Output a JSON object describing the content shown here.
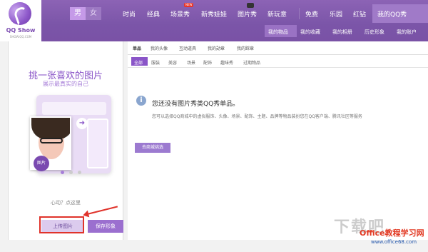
{
  "header": {
    "logo_text": "QQ Show",
    "logo_sub": "SHOW.QQ.COM",
    "gender": [
      "男",
      "女"
    ],
    "nav": [
      "时尚",
      "经典",
      "场景秀",
      "新秀娃娃",
      "图片秀",
      "新玩意",
      "免费",
      "乐园",
      "红钻",
      "我的QQ秀"
    ],
    "new_badge": "NEW",
    "sub_nav": [
      "我的物品",
      "我的收藏",
      "我的相册",
      "历史形象",
      "我的账户"
    ]
  },
  "left_panel": {
    "title": "挑一张喜欢的图片",
    "subtitle": "展示最真实的自己",
    "pic_badge": "图片",
    "hint": "心动？点这里",
    "upload_label": "上传图片",
    "save_label": "保存形象"
  },
  "main": {
    "tabs": [
      "单品",
      "我的头像",
      "互动道具",
      "我的勋章",
      "我的踩章"
    ],
    "categories": [
      "全部",
      "服装",
      "美容",
      "场景",
      "配饰",
      "趣味秀",
      "过期物品"
    ],
    "empty_title": "您还没有图片秀类QQ秀单品。",
    "empty_desc": "您可以选择QQ商城中的虚拟服饰、头像、场景、配饰、主题、品牌等物品装扮您在QQ客户端、腾讯社区等服务",
    "shop_button": "去商城挑选"
  },
  "watermark": {
    "brand": "Office教程学习网",
    "url": "www.office68.com",
    "mark": "下载吧"
  },
  "colors": {
    "accent": "#8a55c8",
    "header": "#7b55a8",
    "highlight": "#e0332b"
  }
}
